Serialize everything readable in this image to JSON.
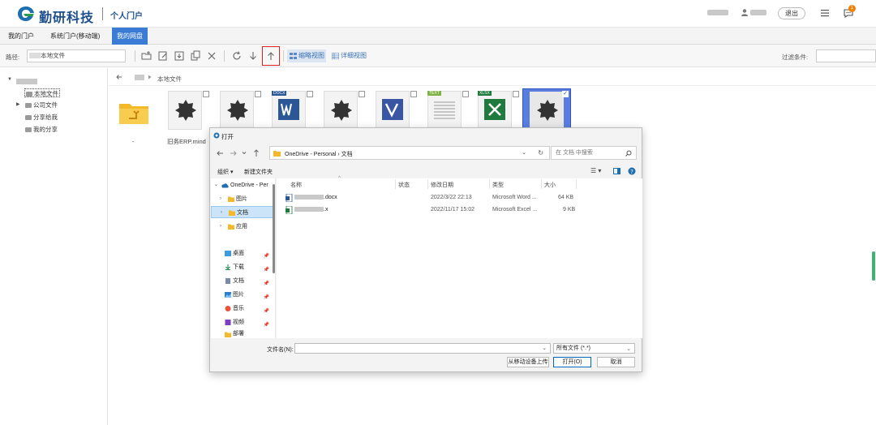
{
  "header": {
    "brand": "勤研科技",
    "portal": "个人门户",
    "logout_label": "退出",
    "badge_count": "1"
  },
  "nav": {
    "tabs": [
      {
        "label": "我的门户"
      },
      {
        "label": "系统门户(移动端)"
      },
      {
        "label": "我的网盘"
      }
    ]
  },
  "toolbar": {
    "path_label": "路径:",
    "path_value": "\\本地文件",
    "view_thumb": "缩略视图",
    "view_detail": "详细视图",
    "filter_label": "过滤条件:"
  },
  "tree": {
    "items": [
      {
        "label": "本地文件"
      },
      {
        "label": "公司文件"
      },
      {
        "label": "分享给我"
      },
      {
        "label": "我的分享"
      }
    ]
  },
  "breadcrumb": {
    "current": "本地文件"
  },
  "files": {
    "tags": [
      "DOCX",
      "TEXT",
      "XLSX"
    ],
    "names": [
      "-",
      "旧务ERP.mind"
    ]
  },
  "dialog": {
    "title": "打开",
    "address": "OneDrive - Personal  ›  文档",
    "search_placeholder": "在 文档 中搜索",
    "organize": "组织 ▾",
    "new_folder": "新建文件夹",
    "sidebar": [
      {
        "label": "OneDrive - Per"
      },
      {
        "label": "图片"
      },
      {
        "label": "文档"
      },
      {
        "label": "应用"
      },
      {
        "label": "桌面"
      },
      {
        "label": "下载"
      },
      {
        "label": "文档"
      },
      {
        "label": "图片"
      },
      {
        "label": "音乐"
      },
      {
        "label": "视频"
      },
      {
        "label": "部署"
      }
    ],
    "columns": {
      "name": "名称",
      "status": "状态",
      "date": "修改日期",
      "type": "类型",
      "size": "大小"
    },
    "rows": [
      {
        "name_suffix": ".docx",
        "date": "2022/3/22 22:13",
        "type": "Microsoft Word ...",
        "size": "64 KB"
      },
      {
        "name_suffix": ".x",
        "date": "2022/11/17 15:02",
        "type": "Microsoft Excel ...",
        "size": "9 KB"
      }
    ],
    "filename_label": "文件名(N):",
    "filetype": "所有文件 (*.*)",
    "btn_mobile": "从移动设备上传",
    "btn_open": "打开(O)",
    "btn_cancel": "取消"
  },
  "colors": {
    "accent": "#3a7bd5",
    "brand": "#1d4f8c",
    "highlight": "#e02020"
  }
}
